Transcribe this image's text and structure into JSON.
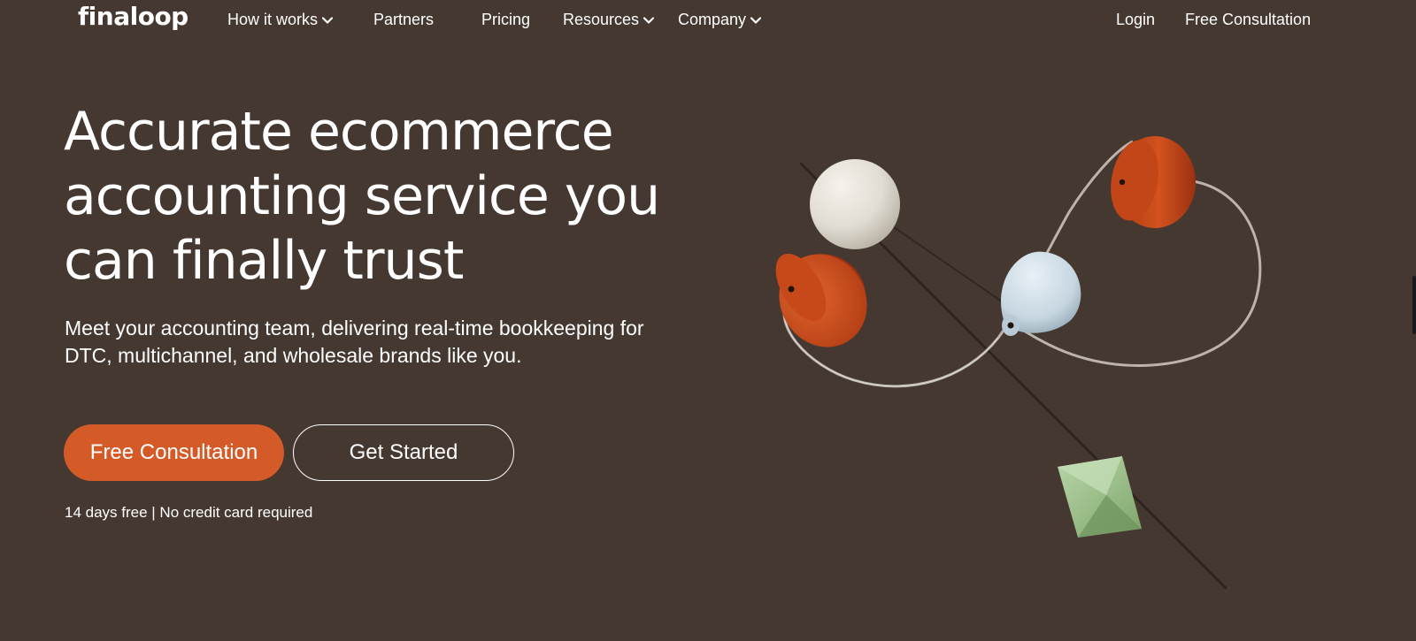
{
  "nav": {
    "logo": "finaloop",
    "items": [
      {
        "label": "How it works",
        "has_dropdown": true
      },
      {
        "label": "Partners",
        "has_dropdown": false
      },
      {
        "label": "Pricing",
        "has_dropdown": false
      },
      {
        "label": "Resources",
        "has_dropdown": true
      },
      {
        "label": "Company",
        "has_dropdown": true
      }
    ],
    "login": "Login",
    "consultation": "Free Consultation"
  },
  "hero": {
    "title": "Accurate ecommerce accounting service you can finally trust",
    "subtitle": "Meet your accounting team, delivering real-time bookkeeping for DTC, multichannel, and wholesale brands like you.",
    "primary_button": "Free Consultation",
    "secondary_button": "Get Started",
    "note": "14 days free | No credit card required"
  },
  "colors": {
    "background": "#443830",
    "accent": "#d45b27",
    "sphere": "#e6e1d8",
    "cone_light": "#cfdde6",
    "cylinder": "#c4461d",
    "diamond": "#9fc18f"
  }
}
